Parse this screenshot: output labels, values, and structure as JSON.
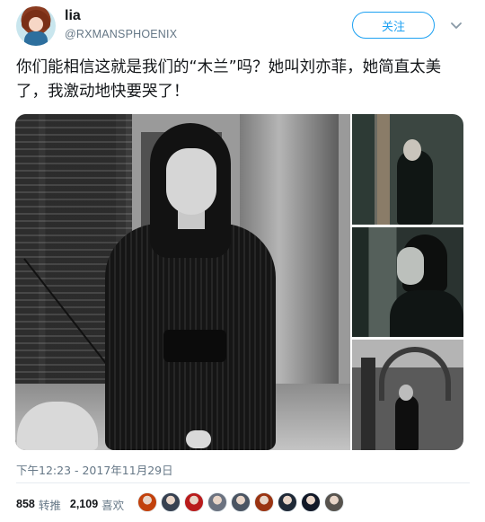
{
  "user": {
    "name": "lia",
    "handle": "@RXMANSPHOENIX"
  },
  "actions": {
    "follow_label": "关注",
    "more_icon": "chevron-down-icon"
  },
  "tweet": {
    "text": "你们能相信这就是我们的“木兰”吗？她叫刘亦菲，她简直太美了，我激动地快要哭了！",
    "timestamp": "下午12:23 - 2017年11月29日"
  },
  "stats": {
    "retweets_count": "858",
    "retweets_label": "转推",
    "likes_count": "2,109",
    "likes_label": "喜欢"
  },
  "likers": [
    {
      "color": "#c2410c"
    },
    {
      "color": "#374151"
    },
    {
      "color": "#b91c1c"
    },
    {
      "color": "#6b7280"
    },
    {
      "color": "#4b5563"
    },
    {
      "color": "#9a3412"
    },
    {
      "color": "#1f2937"
    },
    {
      "color": "#111827"
    },
    {
      "color": "#57534e"
    }
  ]
}
